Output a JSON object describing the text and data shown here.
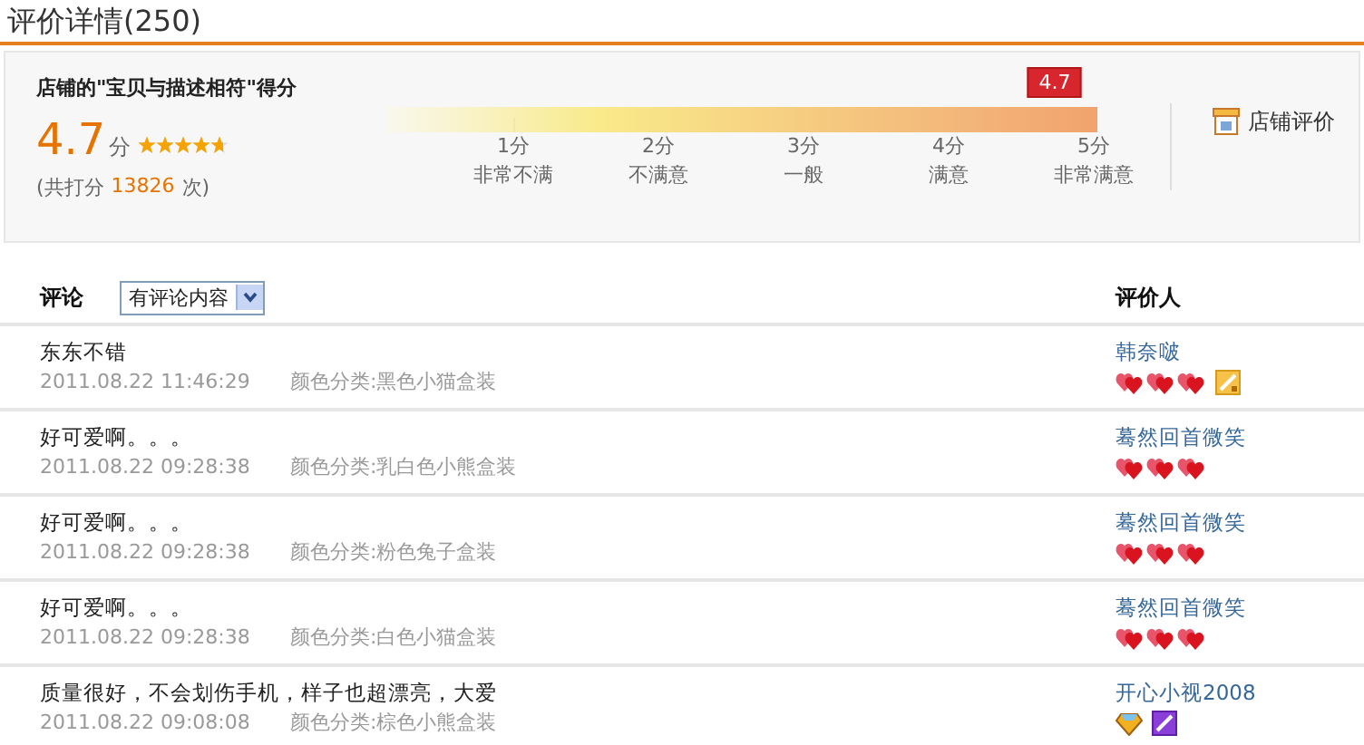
{
  "title": "评价详情(250)",
  "summary": {
    "heading": "店铺的\"宝贝与描述相符\"得分",
    "score": "4.7",
    "unit": "分",
    "stars": 4.7,
    "total_prefix": "(共打分",
    "total_count": "13826",
    "total_suffix": "次)",
    "scale": {
      "marker": "4.7",
      "ticks": [
        {
          "score": "1分",
          "label": "非常不满"
        },
        {
          "score": "2分",
          "label": "不满意"
        },
        {
          "score": "3分",
          "label": "一般"
        },
        {
          "score": "4分",
          "label": "满意"
        },
        {
          "score": "5分",
          "label": "非常满意"
        }
      ]
    },
    "shop_link": "店铺评价"
  },
  "table": {
    "comment_header": "评论",
    "filter": "有评论内容",
    "reviewer_header": "评价人",
    "rows": [
      {
        "comment": "东东不错",
        "time": "2011.08.22 11:46:29",
        "variant": "颜色分类:黑色小猫盒装",
        "reviewer": "韩奈啵",
        "badges": [
          {
            "kind": "heart"
          },
          {
            "kind": "heart"
          },
          {
            "kind": "heart"
          },
          {
            "kind": "member"
          }
        ]
      },
      {
        "comment": "好可爱啊。。。",
        "time": "2011.08.22 09:28:38",
        "variant": "颜色分类:乳白色小熊盒装",
        "reviewer": "蓦然回首微笑",
        "badges": [
          {
            "kind": "heart"
          },
          {
            "kind": "heart"
          },
          {
            "kind": "heart"
          }
        ]
      },
      {
        "comment": "好可爱啊。。。",
        "time": "2011.08.22 09:28:38",
        "variant": "颜色分类:粉色兔子盒装",
        "reviewer": "蓦然回首微笑",
        "badges": [
          {
            "kind": "heart"
          },
          {
            "kind": "heart"
          },
          {
            "kind": "heart"
          }
        ]
      },
      {
        "comment": "好可爱啊。。。",
        "time": "2011.08.22 09:28:38",
        "variant": "颜色分类:白色小猫盒装",
        "reviewer": "蓦然回首微笑",
        "badges": [
          {
            "kind": "heart"
          },
          {
            "kind": "heart"
          },
          {
            "kind": "heart"
          }
        ]
      },
      {
        "comment": "质量很好，不会划伤手机，样子也超漂亮，大爱",
        "time": "2011.08.22 09:08:08",
        "variant": "颜色分类:棕色小熊盒装",
        "reviewer": "开心小视2008",
        "badges": [
          {
            "kind": "diamond"
          },
          {
            "kind": "vip"
          }
        ]
      }
    ]
  }
}
